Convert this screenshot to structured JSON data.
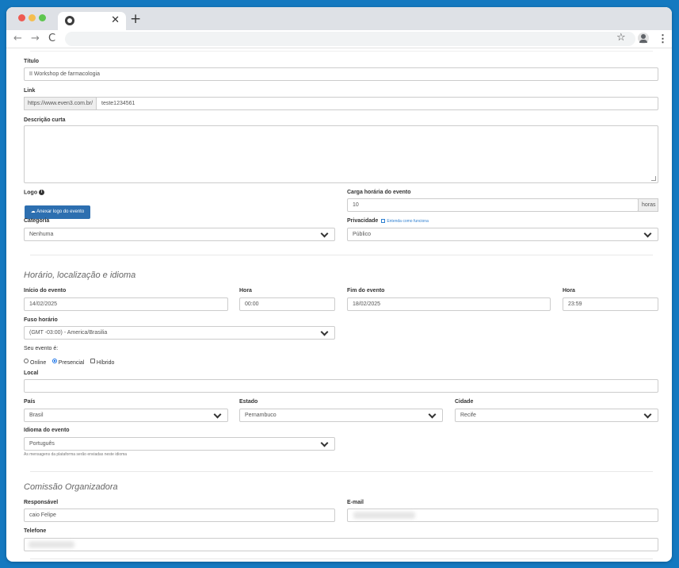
{
  "browser": {
    "tab_close": "✕",
    "new_tab": "+",
    "nav_back": "←",
    "nav_forward": "→",
    "nav_reload": "C",
    "star": "☆",
    "menu": "⋮"
  },
  "form": {
    "titulo": {
      "label": "Título",
      "value": "II Workshop de farmacologia"
    },
    "link": {
      "label": "Link",
      "prefix": "https://www.even3.com.br/",
      "value": "teste1234561"
    },
    "descricao": {
      "label": "Descrição curta",
      "value": ""
    },
    "logo": {
      "label": "Logo",
      "info": "i",
      "button": "Anexar logo do evento"
    },
    "carga": {
      "label": "Carga horária do evento",
      "value": "10",
      "unit": "horas"
    },
    "categoria": {
      "label": "Categoria",
      "value": "Nenhuma"
    },
    "privacidade": {
      "label": "Privacidade",
      "help": "Entenda como funciona",
      "value": "Público"
    }
  },
  "sections": {
    "horario": "Horário, localização e idioma",
    "comissao": "Comissão Organizadora"
  },
  "schedule": {
    "inicio": {
      "label": "Início do evento",
      "value": "14/02/2025"
    },
    "hora_inicio": {
      "label": "Hora",
      "value": "00:00"
    },
    "fim": {
      "label": "Fim do evento",
      "value": "18/02/2025"
    },
    "hora_fim": {
      "label": "Hora",
      "value": "23:59"
    },
    "fuso": {
      "label": "Fuso horário",
      "value": "(GMT -03:00) - America/Brasilia"
    },
    "modalidade": {
      "label": "Seu evento é:",
      "options": [
        "Online",
        "Presencial",
        "Híbrido"
      ],
      "selected": "Presencial"
    },
    "local": {
      "label": "Local",
      "value": ""
    },
    "pais": {
      "label": "País",
      "value": "Brasil"
    },
    "estado": {
      "label": "Estado",
      "value": "Pernambuco"
    },
    "cidade": {
      "label": "Cidade",
      "value": "Recife"
    },
    "idioma": {
      "label": "Idioma do evento",
      "value": "Português",
      "hint": "As mensagens da plataforma serão enviadas neste idioma"
    }
  },
  "comissao": {
    "responsavel": {
      "label": "Responsável",
      "value": "caio Felipe"
    },
    "email": {
      "label": "E-mail",
      "value": ""
    },
    "telefone": {
      "label": "Telefone",
      "value": ""
    }
  }
}
